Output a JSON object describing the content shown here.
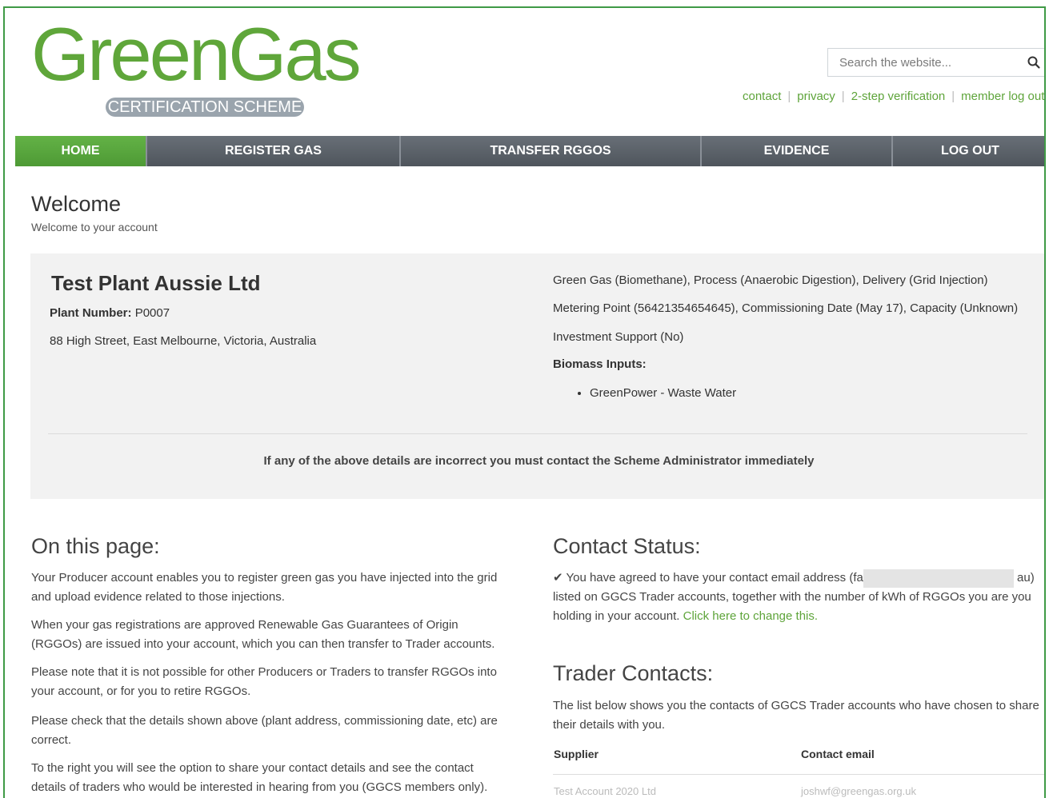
{
  "logo": {
    "wordmark": "GreenGas",
    "subtitle": "CERTIFICATION SCHEME"
  },
  "search": {
    "placeholder": "Search the website...",
    "icon": "search-icon"
  },
  "top_links": [
    "contact",
    "privacy",
    "2-step verification",
    "member log out"
  ],
  "nav": {
    "items": [
      "HOME",
      "REGISTER GAS",
      "TRANSFER RGGOS",
      "EVIDENCE",
      "LOG OUT"
    ],
    "active": "HOME"
  },
  "welcome": {
    "title": "Welcome",
    "subtitle": "Welcome to your account"
  },
  "plant": {
    "name": "Test Plant Aussie Ltd",
    "number_label": "Plant Number:",
    "number_value": "P0007",
    "address": "88 High Street, East Melbourne, Victoria, Australia",
    "details": [
      "Green Gas (Biomethane), Process (Anaerobic Digestion), Delivery (Grid Injection)",
      "Metering Point (56421354654645), Commissioning Date (May 17), Capacity (Unknown)",
      "Investment Support (No)"
    ],
    "biomass_label": "Biomass Inputs:",
    "biomass_inputs": [
      "GreenPower - Waste Water"
    ],
    "notice": "If any of the above details are incorrect you must contact the Scheme Administrator immediately"
  },
  "on_this_page": {
    "title": "On this page:",
    "paragraphs": [
      "Your Producer account enables you to register green gas you have injected into the grid and upload evidence related to those injections.",
      "When your gas registrations are approved Renewable Gas Guarantees of Origin (RGGOs) are issued into your account, which you can then transfer to Trader accounts.",
      "Please note that it is not possible for other Producers or Traders to transfer RGGOs into your account, or for you to retire RGGOs.",
      "Please check that the details shown above (plant address, commissioning date, etc) are correct.",
      "To the right you will see the option to share your contact details and see the contact details of traders who would be interested in hearing from you (GGCS members only)."
    ]
  },
  "contact_status": {
    "title": "Contact Status:",
    "text_before": "You have agreed to have your contact email address (fa",
    "text_after": "au)",
    "text_rest": "listed on GGCS Trader accounts, together with the number of kWh of RGGOs you are you holding in your account.",
    "link": "Click here to change this."
  },
  "trader_contacts": {
    "title": "Trader Contacts:",
    "description": "The list below shows you the contacts of GGCS Trader accounts who have chosen to share their details with you.",
    "columns": [
      "Supplier",
      "Contact email"
    ],
    "rows": [
      [
        "Test Account 2020 Ltd",
        "joshwf@greengas.org.uk"
      ]
    ]
  },
  "colors": {
    "brand_green": "#5fa63a",
    "nav_grey": "#5a6068",
    "panel_bg": "#f2f2f2"
  }
}
